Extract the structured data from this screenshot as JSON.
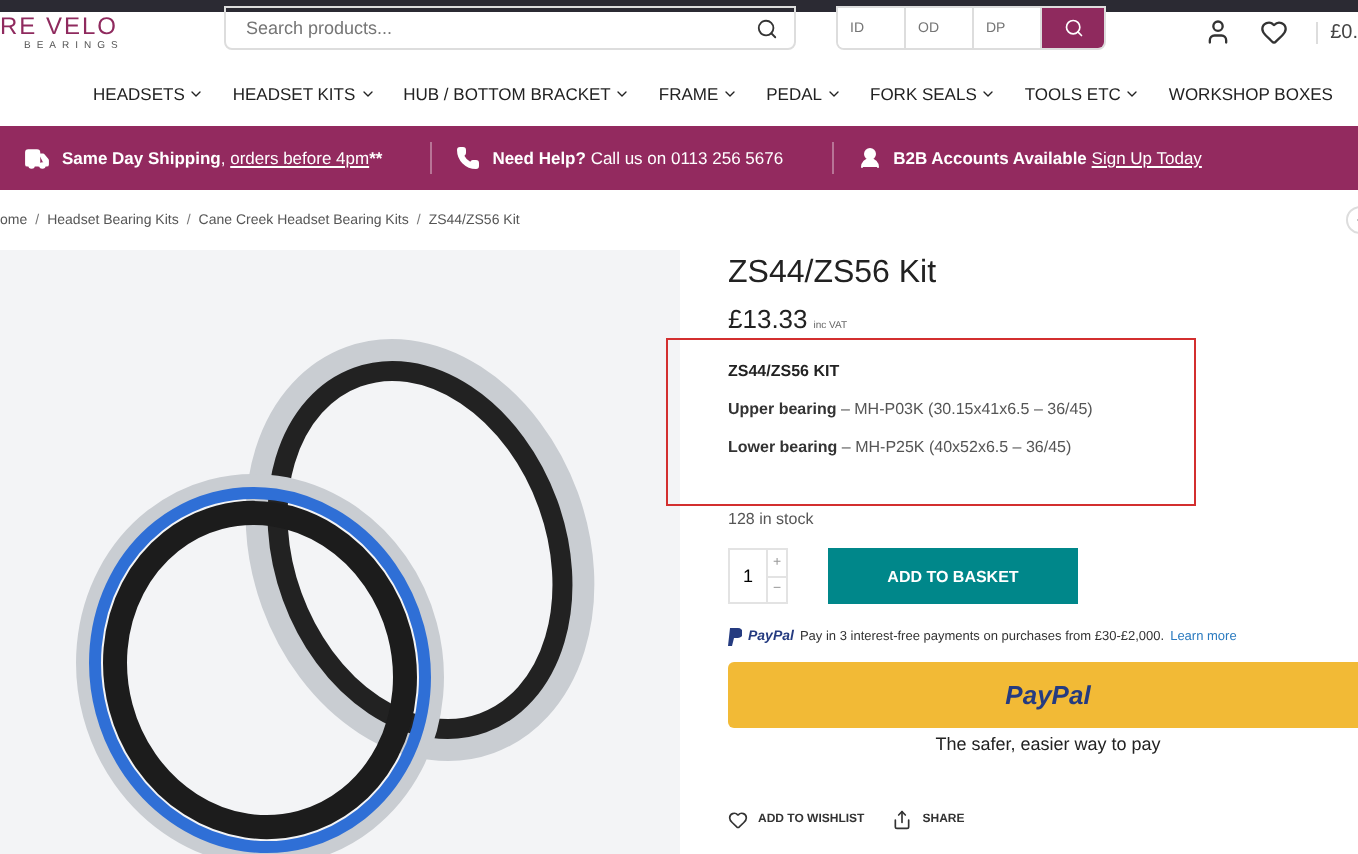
{
  "header": {
    "logo": {
      "name": "RE VELO",
      "tagline": "BEARINGS"
    },
    "search": {
      "placeholder": "Search products..."
    },
    "size_search": [
      {
        "placeholder": "ID"
      },
      {
        "placeholder": "OD"
      },
      {
        "placeholder": "DP"
      }
    ],
    "cart_total": "£0."
  },
  "nav": [
    {
      "label": "HEADSETS",
      "has_menu": true
    },
    {
      "label": "HEADSET KITS",
      "has_menu": true
    },
    {
      "label": "HUB / BOTTOM BRACKET",
      "has_menu": true
    },
    {
      "label": "FRAME",
      "has_menu": true
    },
    {
      "label": "PEDAL",
      "has_menu": true
    },
    {
      "label": "FORK SEALS",
      "has_menu": true
    },
    {
      "label": "TOOLS ETC",
      "has_menu": true
    },
    {
      "label": "WORKSHOP BOXES",
      "has_menu": false
    }
  ],
  "info_bar": [
    {
      "kind": "shipping",
      "text": "**Same Day Shipping**,",
      "link": "orders before 4pm",
      "after": "**"
    },
    {
      "kind": "help",
      "text": "**Need Help?** Call us on 0113 256 5676"
    },
    {
      "kind": "b2b",
      "text": "**B2B Accounts Available**",
      "link": "Sign Up Today"
    }
  ],
  "breadcrumb": {
    "separator": "/",
    "items": [
      "ome",
      "Headset Bearing Kits",
      "Cane Creek Headset Bearing Kits",
      "ZS44/ZS56 Kit"
    ]
  },
  "product": {
    "title": "ZS44/ZS56 Kit",
    "price": "£13.33",
    "price_note": "inc VAT",
    "spec_heading": "ZS44/ZS56 KIT",
    "specs": [
      "**Upper bearing** – MH-P03K (30.15x41x6.5 – 36/45)",
      "**Lower bearing** – MH-P25K (40x52x6.5 – 36/45)"
    ],
    "stock": "128 in stock",
    "quantity": "1",
    "qty_plus": "+",
    "qty_minus": "−",
    "add_button": "ADD TO BASKET",
    "paylater": {
      "brand": "PayPal",
      "text": "Pay in 3 interest-free payments on purchases from £30-£2,000.",
      "link": "Learn more"
    },
    "paypal_button": "PayPal",
    "paypal_tagline": "The safer, easier way to pay",
    "actions": [
      {
        "kind": "wishlist",
        "label": "ADD TO WISHLIST"
      },
      {
        "kind": "share",
        "label": "SHARE"
      }
    ]
  }
}
